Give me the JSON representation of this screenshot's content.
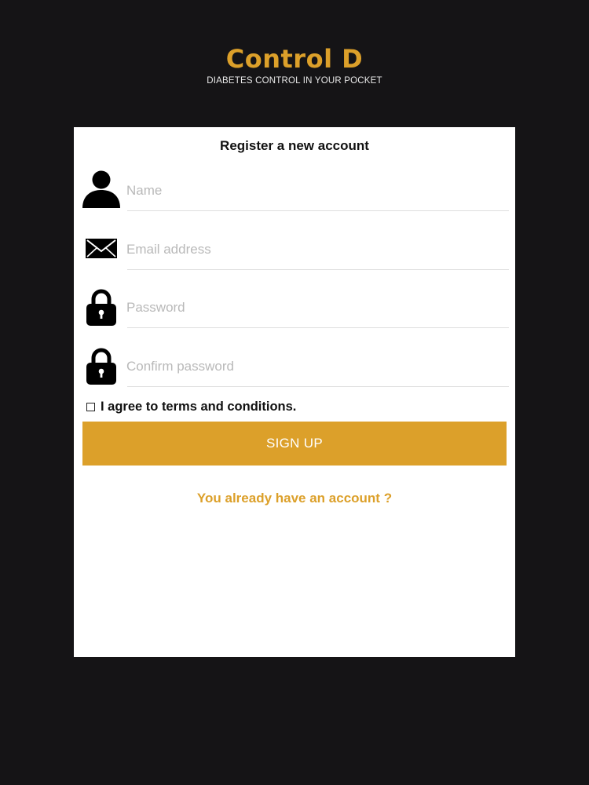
{
  "brand": {
    "title": "Control D",
    "subtitle": "DIABETES CONTROL IN YOUR POCKET"
  },
  "form": {
    "title": "Register a new account",
    "fields": [
      {
        "icon": "person-icon",
        "placeholder": "Name",
        "value": ""
      },
      {
        "icon": "envelope-icon",
        "placeholder": "Email address",
        "value": ""
      },
      {
        "icon": "lock-icon",
        "placeholder": "Password",
        "value": ""
      },
      {
        "icon": "lock-icon",
        "placeholder": "Confirm password",
        "value": ""
      }
    ],
    "agree_label": "I agree to terms and conditions.",
    "agree_checked": false,
    "signup_label": "SIGN UP",
    "login_link": "You already have an account ?"
  },
  "colors": {
    "accent": "#dca02a",
    "background": "#151416",
    "card": "#ffffff"
  }
}
